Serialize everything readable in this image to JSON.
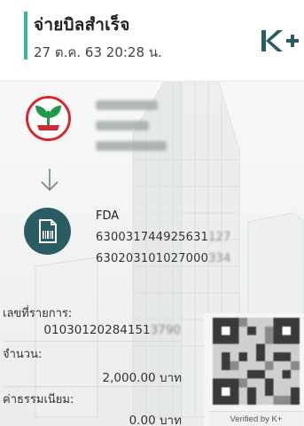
{
  "header": {
    "title": "จ่ายบิลสำเร็จ",
    "datetime": "27 ต.ค. 63  20:28 น.",
    "logo_text": "K+"
  },
  "sender": {
    "bank_icon": "kbank-leaf-icon",
    "name_masked": "น.ส. xxxxx x",
    "bank_masked": "ธ.กสิกรไทย",
    "account_masked": "xxx-x-x2689-x"
  },
  "recipient": {
    "icon": "document-bill-icon",
    "name": "FDA",
    "ref1": "630031744925631",
    "ref1_tail": "127",
    "ref2": "630203101027000",
    "ref2_tail": "334"
  },
  "details": {
    "txn_label": "เลขที่รายการ:",
    "txn_value": "01030120284151",
    "txn_value_tail": "3790",
    "amount_label": "จำนวน:",
    "amount_value": "2,000.00 บาท",
    "fee_label": "ค่าธรรมเนียม:",
    "fee_value": "0.00 บาท"
  },
  "qr": {
    "verified_text": "Verified by K+"
  },
  "colors": {
    "accent": "#2fb7a0",
    "kbank_green": "#1f9a4a",
    "kbank_red": "#d6282f",
    "fda_teal": "#2a5d63"
  }
}
